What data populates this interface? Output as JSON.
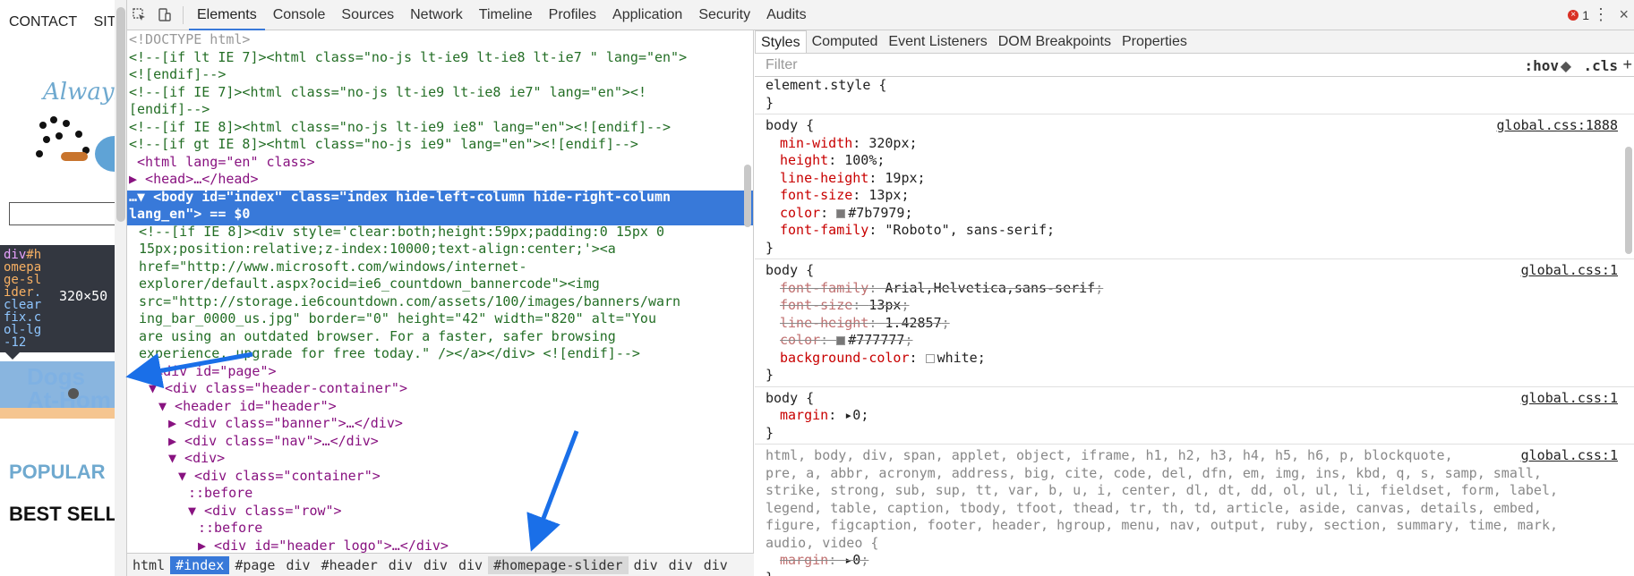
{
  "preview": {
    "topnav": [
      "CONTACT",
      "SITE"
    ],
    "logo_text": "Always",
    "tooltip": {
      "selector_tag": "div",
      "selector_id": "#homepage-slider",
      "selector_classes": ".clearfix.col-lg-12",
      "dimensions": "320×50"
    },
    "slider_text_1": "Dogs",
    "slider_text_2": "At-Hom",
    "popular": "POPULAR",
    "best_sellers": "BEST SELLI"
  },
  "toolbar": {
    "tabs": [
      "Elements",
      "Console",
      "Sources",
      "Network",
      "Timeline",
      "Profiles",
      "Application",
      "Security",
      "Audits"
    ],
    "active_tab": "Elements",
    "error_count": "1"
  },
  "dom": {
    "lines": [
      {
        "indent": 0,
        "kind": "gray",
        "text": "<!DOCTYPE html>"
      },
      {
        "indent": 0,
        "kind": "comment",
        "text": "<!--[if lt IE 7]><html class=\"no-js lt-ie9 lt-ie8 lt-ie7 \" lang=\"en\">"
      },
      {
        "indent": 0,
        "kind": "comment",
        "text": "<![endif]-->"
      },
      {
        "indent": 0,
        "kind": "comment",
        "text": "<!--[if IE 7]><html class=\"no-js lt-ie9 lt-ie8 ie7\" lang=\"en\"><!"
      },
      {
        "indent": 0,
        "kind": "comment",
        "text": "[endif]-->"
      },
      {
        "indent": 0,
        "kind": "comment",
        "text": "<!--[if IE 8]><html class=\"no-js lt-ie9 ie8\" lang=\"en\"><![endif]-->"
      },
      {
        "indent": 0,
        "kind": "comment",
        "text": "<!--[if gt IE 8]><html class=\"no-js ie9\" lang=\"en\"><![endif]-->"
      },
      {
        "indent": 0,
        "kind": "tag",
        "text": " <html lang=\"en\" class>"
      },
      {
        "indent": 0,
        "kind": "tag",
        "text": "▶ <head>…</head>"
      },
      {
        "indent": 0,
        "kind": "selected",
        "text": "…▼ <body id=\"index\" class=\"index hide-left-column hide-right-column"
      },
      {
        "indent": 0,
        "kind": "selected",
        "text": "lang_en\"> == $0"
      },
      {
        "indent": 1,
        "kind": "comment",
        "text": "<!--[if IE 8]><div style='clear:both;height:59px;padding:0 15px 0"
      },
      {
        "indent": 1,
        "kind": "comment",
        "text": "15px;position:relative;z-index:10000;text-align:center;'><a"
      },
      {
        "indent": 1,
        "kind": "comment",
        "text": "href=\"http://www.microsoft.com/windows/internet-"
      },
      {
        "indent": 1,
        "kind": "comment",
        "text": "explorer/default.aspx?ocid=ie6_countdown_bannercode\"><img"
      },
      {
        "indent": 1,
        "kind": "comment",
        "text": "src=\"http://storage.ie6countdown.com/assets/100/images/banners/warn"
      },
      {
        "indent": 1,
        "kind": "comment",
        "text": "ing_bar_0000_us.jpg\" border=\"0\" height=\"42\" width=\"820\" alt=\"You"
      },
      {
        "indent": 1,
        "kind": "comment",
        "text": "are using an outdated browser. For a faster, safer browsing"
      },
      {
        "indent": 1,
        "kind": "comment",
        "text": "experience, upgrade for free today.\" /></a></div> <![endif]-->"
      },
      {
        "indent": 1,
        "kind": "tag",
        "text": "▼ <div id=\"page\">"
      },
      {
        "indent": 2,
        "kind": "tag",
        "text": "▼ <div class=\"header-container\">"
      },
      {
        "indent": 3,
        "kind": "tag",
        "text": "▼ <header id=\"header\">"
      },
      {
        "indent": 4,
        "kind": "tag",
        "text": "▶ <div class=\"banner\">…</div>"
      },
      {
        "indent": 4,
        "kind": "tag",
        "text": "▶ <div class=\"nav\">…</div>"
      },
      {
        "indent": 4,
        "kind": "tag",
        "text": "▼ <div>"
      },
      {
        "indent": 5,
        "kind": "tag",
        "text": "▼ <div class=\"container\">"
      },
      {
        "indent": 6,
        "kind": "pseudo",
        "text": "::before"
      },
      {
        "indent": 6,
        "kind": "tag",
        "text": "▼ <div class=\"row\">"
      },
      {
        "indent": 7,
        "kind": "pseudo",
        "text": "::before"
      },
      {
        "indent": 7,
        "kind": "tag",
        "text": "▶ <div id=\"header_logo\">…</div>"
      }
    ]
  },
  "breadcrumbs": [
    "html",
    "#index",
    "#page",
    "div",
    "#header",
    "div",
    "div",
    "div",
    "#homepage-slider",
    "div",
    "div",
    "div"
  ],
  "breadcrumb_active": "#index",
  "breadcrumb_hover": "#homepage-slider",
  "styles": {
    "subtabs": [
      "Styles",
      "Computed",
      "Event Listeners",
      "DOM Breakpoints",
      "Properties"
    ],
    "active_subtab": "Styles",
    "filter_placeholder": "Filter",
    "hov": ":hov",
    "cls": ".cls",
    "plus": "+",
    "element_style": "element.style {",
    "close_brace": "}",
    "rule1": {
      "selector": "body {",
      "source": "global.css:1888",
      "props": [
        [
          "min-width",
          "320px"
        ],
        [
          "height",
          "100%"
        ],
        [
          "line-height",
          "19px"
        ],
        [
          "font-size",
          "13px"
        ],
        [
          "color",
          "#7b7979"
        ],
        [
          "font-family",
          "\"Roboto\", sans-serif"
        ]
      ]
    },
    "rule2": {
      "selector": "body {",
      "source": "global.css:1",
      "props": [
        [
          "font-family",
          "Arial,Helvetica,sans-serif",
          "struck"
        ],
        [
          "font-size",
          "13px",
          "struck"
        ],
        [
          "line-height",
          "1.42857",
          "struck"
        ],
        [
          "color",
          "#777777",
          "struck"
        ],
        [
          "background-color",
          "white",
          ""
        ]
      ]
    },
    "rule3": {
      "selector": "body {",
      "source": "global.css:1",
      "props": [
        [
          "margin",
          "▸0"
        ]
      ]
    },
    "rule4": {
      "source": "global.css:1",
      "selector_lines": [
        "html, body, div, span, applet, object, iframe, h1, h2, h3, h4, h5, h6, p, blockquote,",
        "pre, a, abbr, acronym, address, big, cite, code, del, dfn, em, img, ins, kbd, q, s, samp, small,",
        "strike, strong, sub, sup, tt, var, b, u, i, center, dl, dt, dd, ol, ul, li, fieldset, form, label,",
        "legend, table, caption, tbody, tfoot, thead, tr, th, td, article, aside, canvas, details, embed,",
        "figure, figcaption, footer, header, hgroup, menu, nav, output, ruby, section, summary, time, mark,",
        "audio, video {"
      ],
      "props": [
        [
          "margin",
          "▸0",
          "struck"
        ]
      ]
    }
  },
  "colors": {
    "accent": "#3879d9",
    "arrow": "#1a6fe8",
    "swatch_1": "#7b7979",
    "swatch_2": "#777777",
    "swatch_3": "#ffffff"
  }
}
